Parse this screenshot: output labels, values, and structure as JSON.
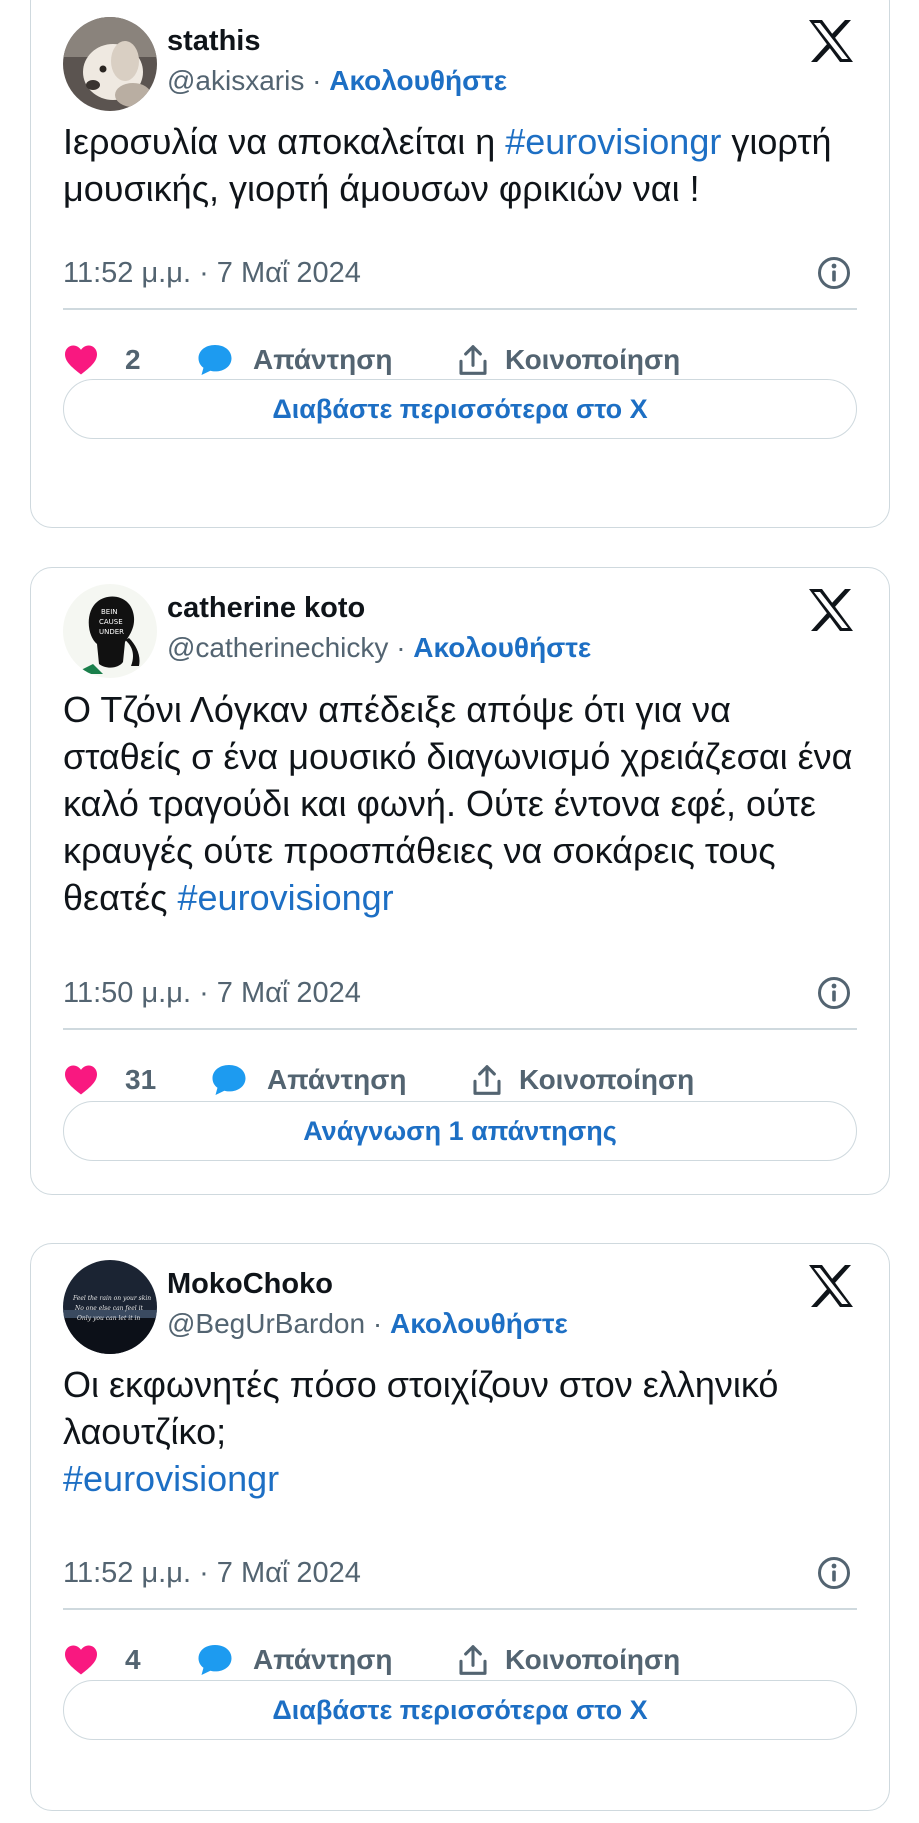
{
  "colors": {
    "accent": "#1d6fc4",
    "like": "#f91880",
    "muted": "#536471",
    "border": "#cfd9de"
  },
  "tweets": [
    {
      "name": "stathis",
      "handle": "@akisxaris",
      "separator": "·",
      "follow_label": "Ακολουθήστε",
      "text_parts": [
        "Ιεροσυλία να αποκαλείται η ",
        "#eurovisiongr",
        " γιορτή μουσικής, γιορτή άμουσων φρικιών ναι !"
      ],
      "timestamp": "11:52 μ.μ. · 7 Μαΐ 2024",
      "likes": "2",
      "reply_label": "Απάντηση",
      "share_label": "Κοινοποίηση",
      "button_label": "Διαβάστε περισσότερα στο X"
    },
    {
      "name": "catherine koto",
      "handle": "@catherinechicky",
      "separator": "·",
      "follow_label": "Ακολουθήστε",
      "text_parts": [
        "Ο Τζόνι Λόγκαν απέδειξε απόψε ότι για να σταθείς σ ένα μουσικό διαγωνισμό χρειάζεσαι ένα καλό τραγούδι και φωνή. Ούτε έντονα εφέ, ούτε κραυγές ούτε προσπάθειες να σοκάρεις τους θεατές ",
        "#eurovisiongr"
      ],
      "timestamp": "11:50 μ.μ. · 7 Μαΐ 2024",
      "likes": "31",
      "reply_label": "Απάντηση",
      "share_label": "Κοινοποίηση",
      "button_label": "Ανάγνωση 1 απάντησης"
    },
    {
      "name": "MokoChoko",
      "handle": "@BegUrBardon",
      "separator": "·",
      "follow_label": "Ακολουθήστε",
      "text_parts": [
        "Οι εκφωνητές πόσο στοιχίζουν στον ελληνικό λαουτζίκο;",
        "#eurovisiongr"
      ],
      "timestamp": "11:52 μ.μ. · 7 Μαΐ 2024",
      "likes": "4",
      "reply_label": "Απάντηση",
      "share_label": "Κοινοποίηση",
      "button_label": "Διαβάστε περισσότερα στο X"
    }
  ]
}
